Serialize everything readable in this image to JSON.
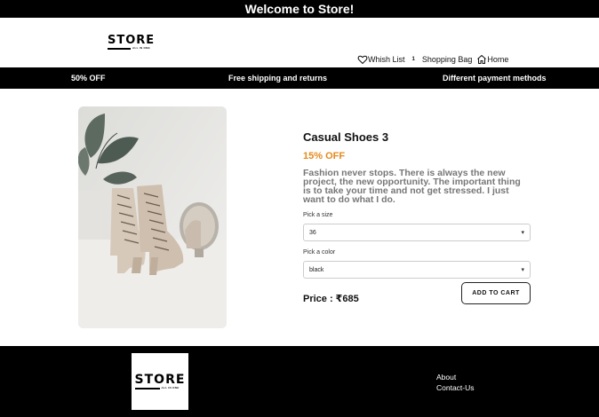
{
  "topbar": {
    "title": "Welcome to Store!"
  },
  "header": {
    "logo": {
      "text": "STORE",
      "tagline": "ALL IN ONE"
    },
    "nav": {
      "wishlist_label": "Whish List",
      "bag_count": "1",
      "bag_label": "Shopping Bag",
      "home_label": "Home"
    }
  },
  "promos": {
    "left": "50% OFF",
    "center": "Free shipping and returns",
    "right": "Different payment methods"
  },
  "product": {
    "title": "Casual Shoes 3",
    "discount": "15% OFF",
    "description": "Fashion never stops. There is always the new project, the new opportunity. The important thing is to take your time and not get stressed. I just want to do what I do.",
    "size_label": "Pick a size",
    "size_value": "36",
    "color_label": "Pick a color",
    "color_value": "black",
    "price": "Price : ₹685",
    "add_to_cart": "ADD TO CART"
  },
  "footer": {
    "logo": {
      "text": "STORE",
      "tagline": "ALL IN ONE"
    },
    "links": [
      "About",
      "Contact-Us"
    ]
  },
  "colors": {
    "accent": "#e38a1c",
    "bar": "#000000"
  }
}
